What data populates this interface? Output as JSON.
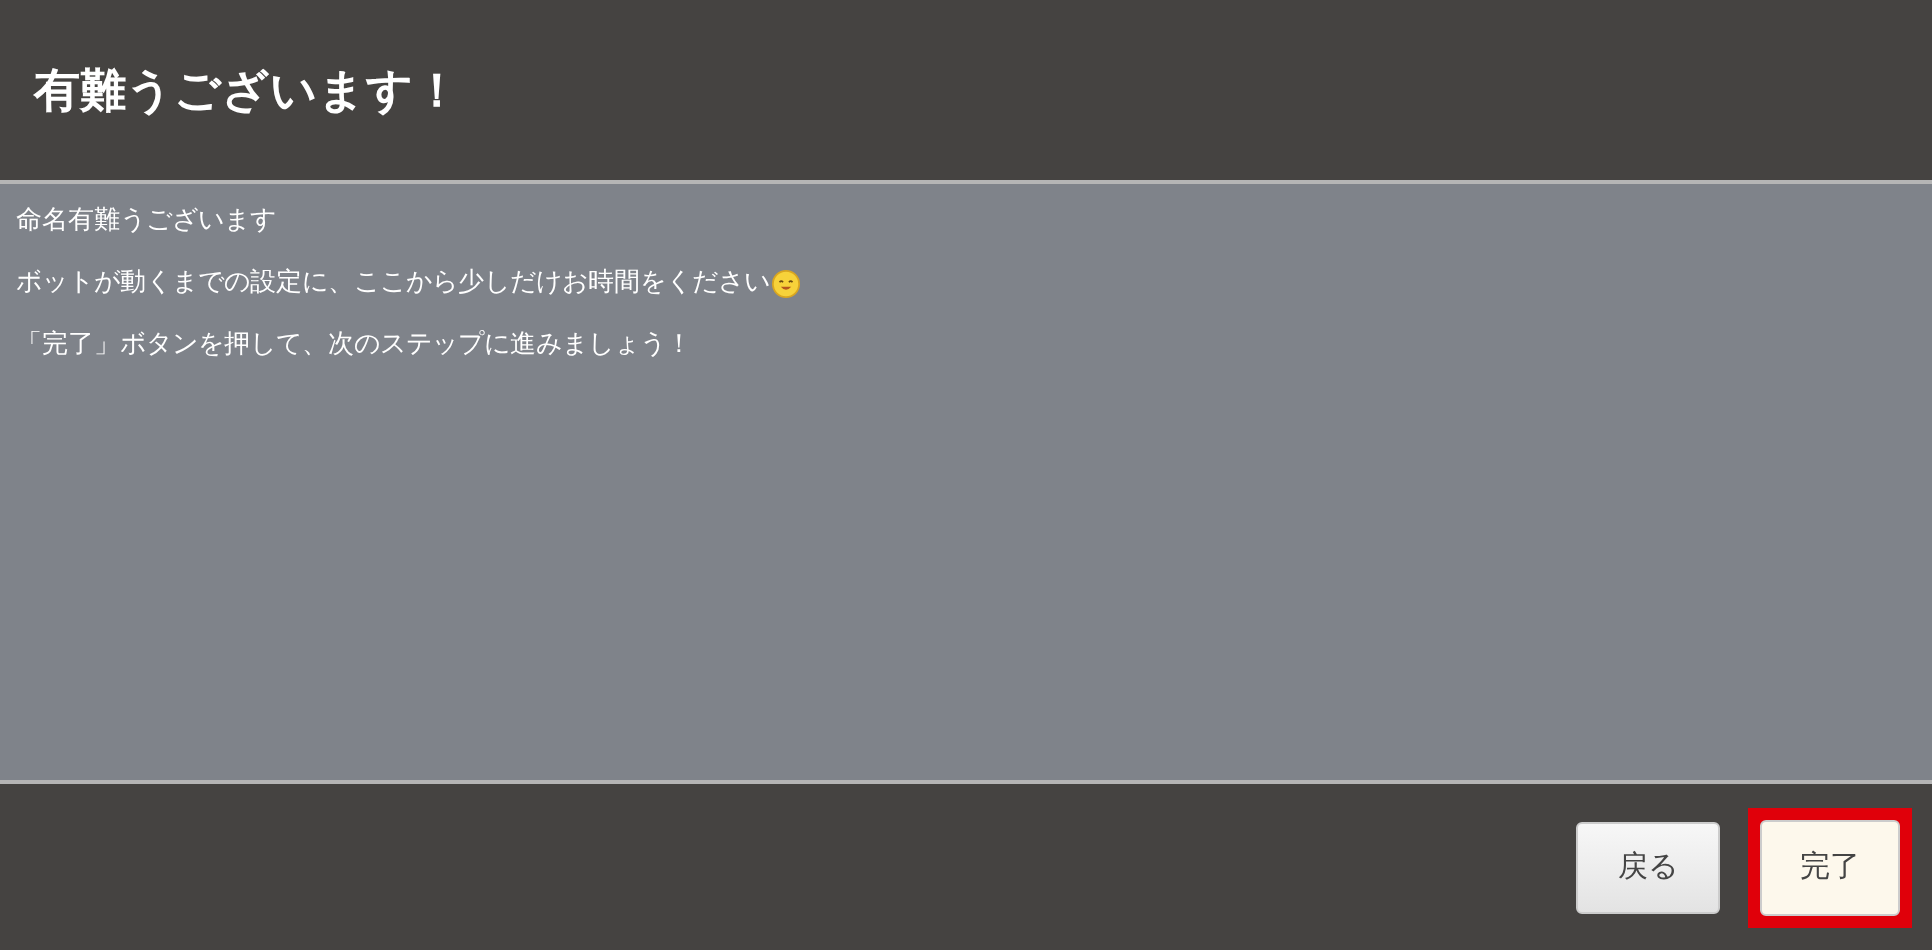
{
  "dialog": {
    "title": "有難うございます！"
  },
  "messages": [
    {
      "text": "命名有難うございます",
      "emoji": false
    },
    {
      "text": "ボットが動くまでの設定に、ここから少しだけお時間をください",
      "emoji": true
    },
    {
      "text": "「完了」ボタンを押して、次のステップに進みましょう！",
      "emoji": false
    }
  ],
  "buttons": [
    {
      "label": "戻る",
      "kind": "secondary",
      "highlighted": false
    },
    {
      "label": "完了",
      "kind": "primary",
      "highlighted": true
    }
  ]
}
